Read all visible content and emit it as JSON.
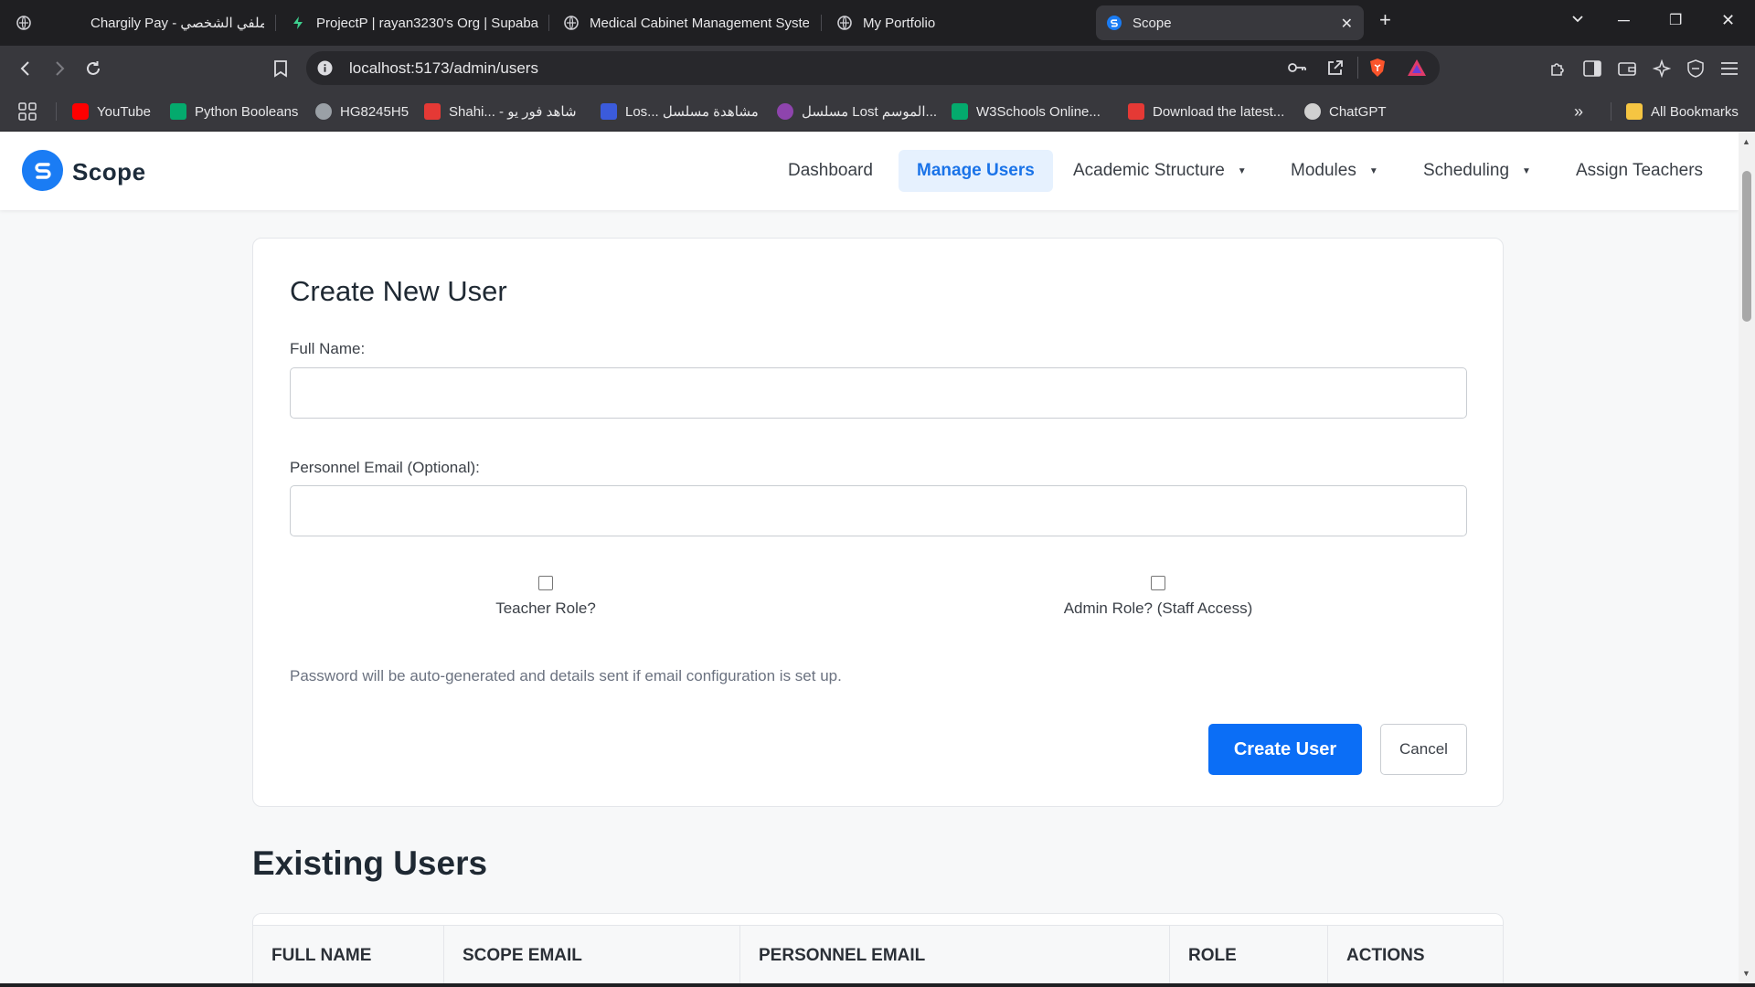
{
  "browser": {
    "tabs": [
      {
        "title": "Chargily Pay - ملفي الشخصي",
        "icon": "globe-icon"
      },
      {
        "title": "ProjectP | rayan3230's Org | Supaba",
        "icon": "supabase-icon"
      },
      {
        "title": "Medical Cabinet Management Syste",
        "icon": "globe-icon"
      },
      {
        "title": "My Portfolio",
        "icon": "globe-icon"
      },
      {
        "title": "Scope",
        "icon": "scope-icon"
      }
    ],
    "url": "localhost:5173/admin/users",
    "bookmarks": [
      {
        "label": "YouTube",
        "color": "#ff0000"
      },
      {
        "label": "Python Booleans",
        "color": "#04aa6d"
      },
      {
        "label": "HG8245H5",
        "color": "#9aa0a6"
      },
      {
        "label": "Shahi... - شاهد فور يو",
        "color": "#e53935"
      },
      {
        "label": "Los... مشاهدة مسلسل",
        "color": "#3b5bdb"
      },
      {
        "label": "مسلسل Lost الموسم...",
        "color": "#8e44ad"
      },
      {
        "label": "W3Schools Online...",
        "color": "#04aa6d"
      },
      {
        "label": "Download the latest...",
        "color": "#e53935"
      },
      {
        "label": "ChatGPT",
        "color": "#d0d0d0"
      }
    ],
    "all_bookmarks": "All Bookmarks"
  },
  "app": {
    "brand": "Scope",
    "nav": {
      "dashboard": "Dashboard",
      "manage_users": "Manage Users",
      "academic_structure": "Academic Structure",
      "modules": "Modules",
      "scheduling": "Scheduling",
      "assign_teachers": "Assign Teachers"
    },
    "accent_color": "#1a73e8"
  },
  "form": {
    "title": "Create New User",
    "full_name_label": "Full Name:",
    "full_name_value": "",
    "email_label": "Personnel Email (Optional):",
    "email_value": "",
    "teacher_role_label": "Teacher Role?",
    "teacher_role_checked": false,
    "admin_role_label": "Admin Role? (Staff Access)",
    "admin_role_checked": false,
    "note": "Password will be auto-generated and details sent if email configuration is set up.",
    "create_button": "Create User",
    "cancel_button": "Cancel"
  },
  "users_table": {
    "title": "Existing Users",
    "columns": [
      "FULL NAME",
      "SCOPE EMAIL",
      "PERSONNEL EMAIL",
      "ROLE",
      "ACTIONS"
    ]
  }
}
